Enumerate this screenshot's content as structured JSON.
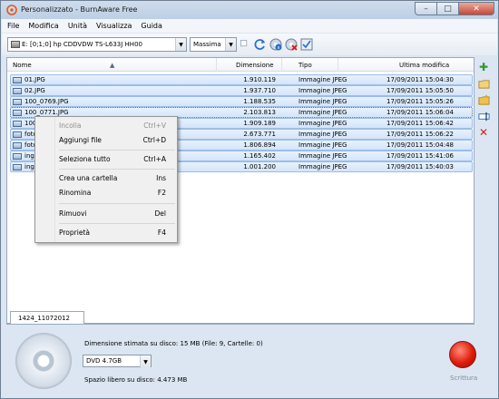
{
  "window": {
    "title": "Personalizzato - BurnAware Free",
    "controls": [
      "minimize-icon",
      "maximize-icon",
      "close-icon"
    ]
  },
  "menu": [
    "File",
    "Modifica",
    "Unità",
    "Visualizza",
    "Guida"
  ],
  "toolbar": {
    "drive": "E: [0;1;0] hp      CDDVDW TS-L633J  HH00",
    "speed": "Massima"
  },
  "columns": {
    "name": "Nome",
    "size": "Dimensione",
    "type": "Tipo",
    "modified": "Ultima modifica"
  },
  "files": [
    {
      "name": "01.JPG",
      "size": "1.910.119",
      "type": "Immagine JPEG",
      "date": "17/09/2011 15:04:30"
    },
    {
      "name": "02.JPG",
      "size": "1.937.710",
      "type": "Immagine JPEG",
      "date": "17/09/2011 15:05:50"
    },
    {
      "name": "100_0769.JPG",
      "size": "1.188.535",
      "type": "Immagine JPEG",
      "date": "17/09/2011 15:05:26"
    },
    {
      "name": "100_0771.JPG",
      "size": "2.103.813",
      "type": "Immagine JPEG",
      "date": "17/09/2011 15:06:04"
    },
    {
      "name": "100_",
      "size": "1.909.189",
      "type": "Immagine JPEG",
      "date": "17/09/2011 15:06:42"
    },
    {
      "name": "foto",
      "size": "2.673.771",
      "type": "Immagine JPEG",
      "date": "17/09/2011 15:06:22"
    },
    {
      "name": "foto",
      "size": "1.806.894",
      "type": "Immagine JPEG",
      "date": "17/09/2011 15:04:48"
    },
    {
      "name": "ingr",
      "size": "1.165.402",
      "type": "Immagine JPEG",
      "date": "17/09/2011 15:41:06"
    },
    {
      "name": "ingr",
      "size": "1.001.200",
      "type": "Immagine JPEG",
      "date": "17/09/2011 15:40:03"
    }
  ],
  "context_menu": [
    {
      "label": "Incolla",
      "shortcut": "Ctrl+V",
      "disabled": true
    },
    {
      "label": "Aggiungi file",
      "shortcut": "Ctrl+D",
      "disabled": false
    },
    {
      "label": "Seleziona tutto",
      "shortcut": "Ctrl+A",
      "disabled": false
    },
    {
      "label": "Crea una cartella",
      "shortcut": "Ins",
      "disabled": false
    },
    {
      "label": "Rinomina",
      "shortcut": "F2",
      "disabled": false
    },
    {
      "label": "Rimuovi",
      "shortcut": "Del",
      "disabled": false
    },
    {
      "label": "Proprietà",
      "shortcut": "F4",
      "disabled": false
    }
  ],
  "tab": "1424_11072012",
  "status": {
    "estimate": "Dimensione stimata su disco: 15 MB (File: 9, Cartelle: 0)",
    "disc_type": "DVD 4.7GB",
    "free_space": "Spazio libero su disco: 4.473 MB",
    "burn_label": "Scrittura"
  },
  "colors": {
    "row_fill": "#d3e5fa",
    "row_border": "#9cbde6",
    "burn_button": "#e01b0c",
    "add_icon": "#2e9a2e",
    "remove_icon": "#d21f1f"
  }
}
